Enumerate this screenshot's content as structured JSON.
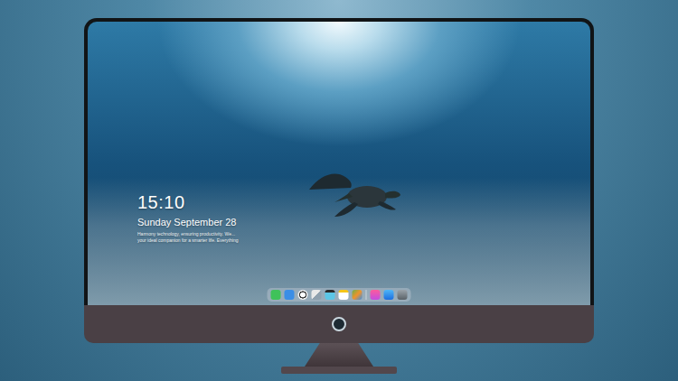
{
  "lock_screen": {
    "time": "15:10",
    "date": "Sunday September 28",
    "caption": [
      "Harmony technology, ensuring productivity. We...",
      "your ideal companion for a smarter life. Everything"
    ]
  }
}
